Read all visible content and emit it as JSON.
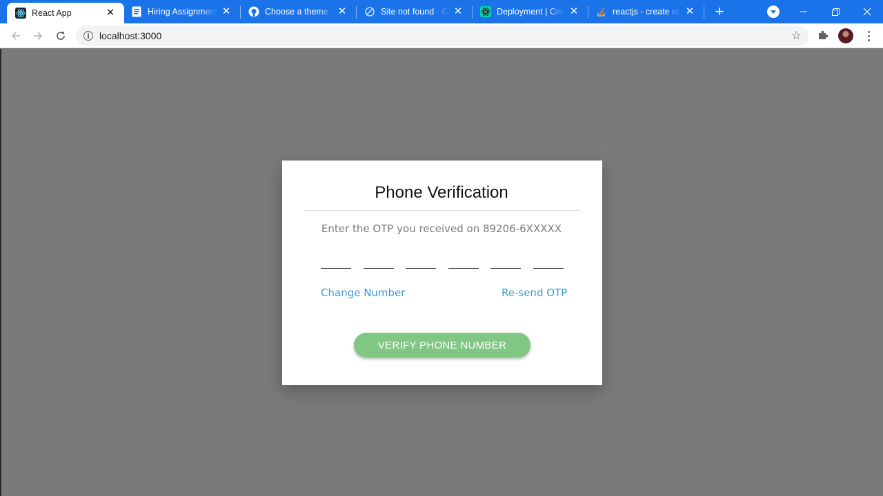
{
  "browser": {
    "tabs": [
      {
        "title": "React App",
        "icon": "react-icon",
        "active": true
      },
      {
        "title": "Hiring Assignment -",
        "icon": "google-docs-icon",
        "active": false
      },
      {
        "title": "Choose a theme",
        "icon": "github-icon",
        "active": false
      },
      {
        "title": "Site not found · GitH",
        "icon": "github-pages-icon",
        "active": false
      },
      {
        "title": "Deployment | Creat",
        "icon": "react-icon",
        "active": false
      },
      {
        "title": "reactjs - create reac",
        "icon": "stackoverflow-icon",
        "active": false
      }
    ],
    "url": "localhost:3000",
    "colors": {
      "tabstrip": "#1a73e8"
    }
  },
  "dialog": {
    "title": "Phone Verification",
    "message": "Enter the OTP you received on 89206-6XXXXX",
    "otp_digits": [
      "",
      "",
      "",
      "",
      "",
      ""
    ],
    "change_number_label": "Change Number",
    "resend_label": "Re-send OTP",
    "verify_label": "VERIFY PHONE NUMBER",
    "colors": {
      "link": "#3a9ad9",
      "button": "#81c784"
    }
  }
}
